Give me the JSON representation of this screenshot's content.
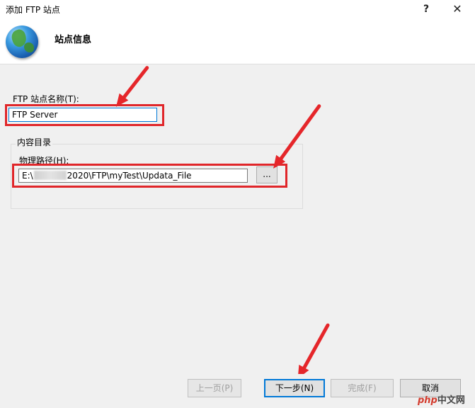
{
  "window": {
    "title": "添加 FTP 站点",
    "help_glyph": "?",
    "close_glyph": "✕"
  },
  "header": {
    "title": "站点信息",
    "icon": "globe-icon"
  },
  "site_name": {
    "label": "FTP 站点名称(T):",
    "value": "FTP Server"
  },
  "content_directory": {
    "group_title": "内容目录",
    "path_label": "物理路径(H):",
    "path_prefix": "E:\\",
    "path_suffix": "2020\\FTP\\myTest\\Updata_File",
    "browse_label": "..."
  },
  "buttons": {
    "previous": "上一页(P)",
    "next": "下一步(N)",
    "finish": "完成(F)",
    "cancel": "取消"
  },
  "watermark": {
    "php": "php",
    "rest": "中文网"
  },
  "colors": {
    "annotation_red": "#e0262a",
    "focus_blue": "#0078d7"
  }
}
